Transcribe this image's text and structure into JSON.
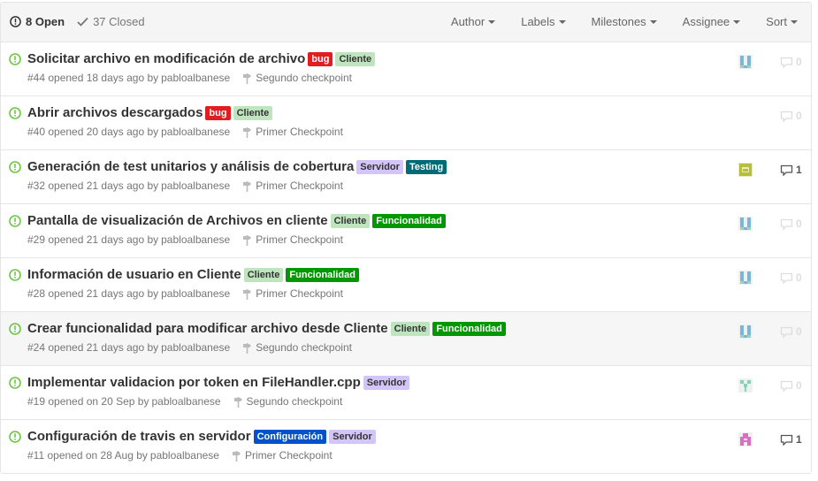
{
  "header": {
    "open_label": "8 Open",
    "closed_label": "37 Closed",
    "filters": [
      "Author",
      "Labels",
      "Milestones",
      "Assignee",
      "Sort"
    ]
  },
  "colors": {
    "open_icon": "#6cc644",
    "bug": "#e11d21",
    "cliente": "#bfe5bf",
    "servidor": "#d4c5f9",
    "testing": "#006b75",
    "funcionalidad": "#009800",
    "configuracion": "#0052cc"
  },
  "issues": [
    {
      "title": "Solicitar archivo en modificación de archivo",
      "labels": [
        {
          "text": "bug",
          "bg": "#e11d21",
          "fg": "#fff"
        },
        {
          "text": "Cliente",
          "bg": "#bfe5bf",
          "fg": "#333"
        }
      ],
      "meta": "#44 opened 18 days ago by",
      "author": "pabloalbanese",
      "milestone": "Segundo checkpoint",
      "assignee": "avatar-teal-blue",
      "comments": "0"
    },
    {
      "title": "Abrir archivos descargados",
      "labels": [
        {
          "text": "bug",
          "bg": "#e11d21",
          "fg": "#fff"
        },
        {
          "text": "Cliente",
          "bg": "#bfe5bf",
          "fg": "#333"
        }
      ],
      "meta": "#40 opened 20 days ago by",
      "author": "pabloalbanese",
      "milestone": "Primer Checkpoint",
      "assignee": "",
      "comments": "0"
    },
    {
      "title": "Generación de test unitarios y análisis de cobertura",
      "labels": [
        {
          "text": "Servidor",
          "bg": "#d4c5f9",
          "fg": "#333"
        },
        {
          "text": "Testing",
          "bg": "#006b75",
          "fg": "#fff"
        }
      ],
      "meta": "#32 opened 21 days ago by",
      "author": "pabloalbanese",
      "milestone": "Primer Checkpoint",
      "assignee": "avatar-olive",
      "comments": "1"
    },
    {
      "title": "Pantalla de visualización de Archivos en cliente",
      "labels": [
        {
          "text": "Cliente",
          "bg": "#bfe5bf",
          "fg": "#333"
        },
        {
          "text": "Funcionalidad",
          "bg": "#009800",
          "fg": "#fff"
        }
      ],
      "meta": "#29 opened 21 days ago by",
      "author": "pabloalbanese",
      "milestone": "Primer Checkpoint",
      "assignee": "avatar-teal-blue",
      "comments": "0"
    },
    {
      "title": "Información de usuario en Cliente",
      "labels": [
        {
          "text": "Cliente",
          "bg": "#bfe5bf",
          "fg": "#333"
        },
        {
          "text": "Funcionalidad",
          "bg": "#009800",
          "fg": "#fff"
        }
      ],
      "meta": "#28 opened 21 days ago by",
      "author": "pabloalbanese",
      "milestone": "Primer Checkpoint",
      "assignee": "avatar-teal-blue",
      "comments": "0"
    },
    {
      "title": "Crear funcionalidad para modificar archivo desde Cliente",
      "labels": [
        {
          "text": "Cliente",
          "bg": "#bfe5bf",
          "fg": "#333"
        },
        {
          "text": "Funcionalidad",
          "bg": "#009800",
          "fg": "#fff"
        }
      ],
      "meta": "#24 opened 21 days ago by",
      "author": "pabloalbanese",
      "milestone": "Segundo checkpoint",
      "assignee": "avatar-teal-blue",
      "comments": "0"
    },
    {
      "title": "Implementar validacion por token en FileHandler.cpp",
      "labels": [
        {
          "text": "Servidor",
          "bg": "#d4c5f9",
          "fg": "#333"
        }
      ],
      "meta": "#19 opened on 20 Sep by",
      "author": "pabloalbanese",
      "milestone": "Segundo checkpoint",
      "assignee": "avatar-mint",
      "comments": "0"
    },
    {
      "title": "Configuración de travis en servidor",
      "labels": [
        {
          "text": "Configuración",
          "bg": "#0052cc",
          "fg": "#fff"
        },
        {
          "text": "Servidor",
          "bg": "#d4c5f9",
          "fg": "#333"
        }
      ],
      "meta": "#11 opened on 28 Aug by",
      "author": "pabloalbanese",
      "milestone": "Primer Checkpoint",
      "assignee": "avatar-pink",
      "comments": "1"
    }
  ]
}
